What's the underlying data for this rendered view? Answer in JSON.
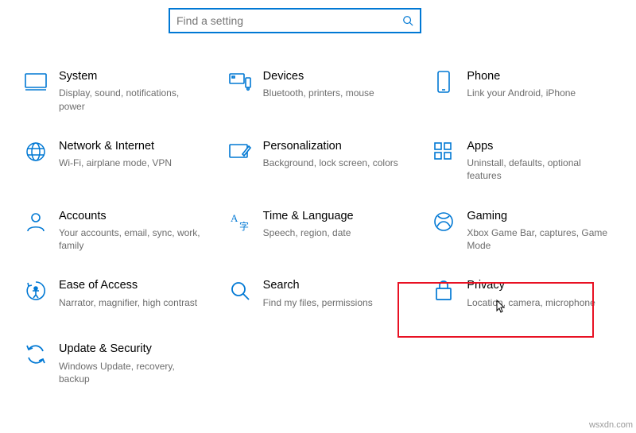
{
  "search": {
    "placeholder": "Find a setting"
  },
  "tiles": {
    "system": {
      "title": "System",
      "desc": "Display, sound, notifications, power"
    },
    "devices": {
      "title": "Devices",
      "desc": "Bluetooth, printers, mouse"
    },
    "phone": {
      "title": "Phone",
      "desc": "Link your Android, iPhone"
    },
    "network": {
      "title": "Network & Internet",
      "desc": "Wi-Fi, airplane mode, VPN"
    },
    "personal": {
      "title": "Personalization",
      "desc": "Background, lock screen, colors"
    },
    "apps": {
      "title": "Apps",
      "desc": "Uninstall, defaults, optional features"
    },
    "accounts": {
      "title": "Accounts",
      "desc": "Your accounts, email, sync, work, family"
    },
    "timelang": {
      "title": "Time & Language",
      "desc": "Speech, region, date"
    },
    "gaming": {
      "title": "Gaming",
      "desc": "Xbox Game Bar, captures, Game Mode"
    },
    "ease": {
      "title": "Ease of Access",
      "desc": "Narrator, magnifier, high contrast"
    },
    "searchcat": {
      "title": "Search",
      "desc": "Find my files, permissions"
    },
    "privacy": {
      "title": "Privacy",
      "desc": "Location, camera, microphone"
    },
    "update": {
      "title": "Update & Security",
      "desc": "Windows Update, recovery, backup"
    }
  },
  "watermark": "wsxdn.com"
}
